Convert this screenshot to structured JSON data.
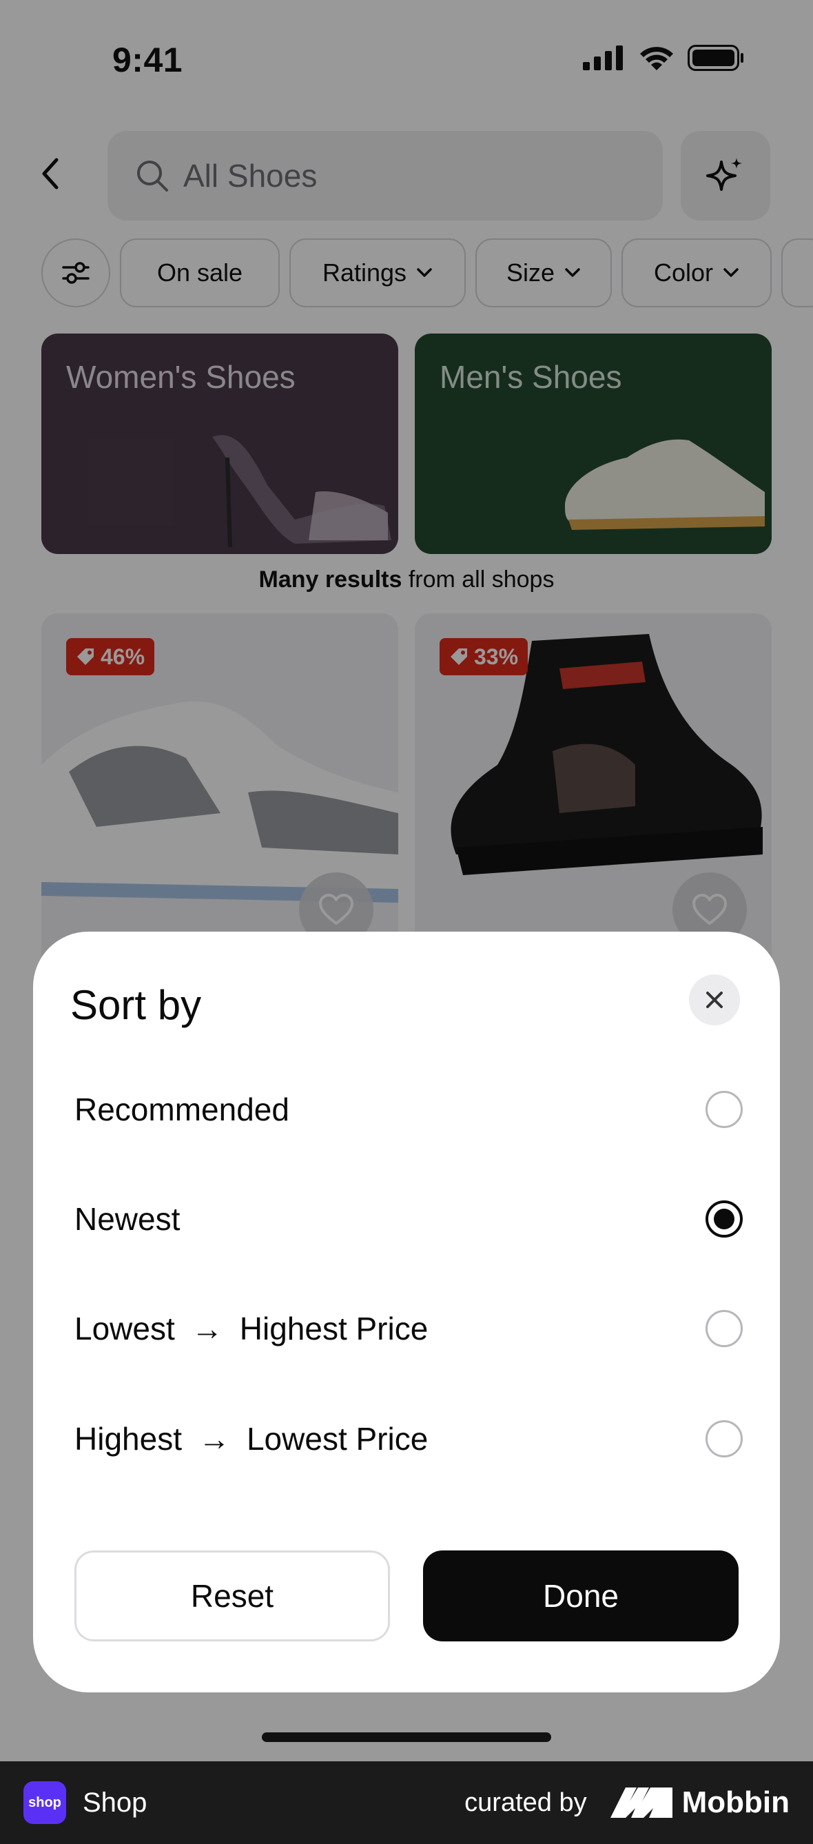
{
  "status_bar": {
    "time": "9:41"
  },
  "search": {
    "placeholder": "All Shoes"
  },
  "filters": {
    "chips": [
      "On sale",
      "Ratings",
      "Size",
      "Color"
    ]
  },
  "categories": [
    {
      "title": "Women's Shoes"
    },
    {
      "title": "Men's Shoes"
    }
  ],
  "results": {
    "bold": "Many results",
    "rest": " from all shops"
  },
  "products": [
    {
      "discount": "46%"
    },
    {
      "discount": "33%"
    }
  ],
  "sort_sheet": {
    "title": "Sort by",
    "options": [
      {
        "label": "Recommended",
        "selected": false
      },
      {
        "label": "Newest",
        "selected": true
      },
      {
        "label_from": "Lowest",
        "label_to": "Highest Price",
        "arrow": "→",
        "selected": false
      },
      {
        "label_from": "Highest",
        "label_to": "Lowest Price",
        "arrow": "→",
        "selected": false
      }
    ],
    "reset_label": "Reset",
    "done_label": "Done"
  },
  "footer": {
    "app_logo_text": "shop",
    "app_name": "Shop",
    "curated_by": "curated by",
    "brand": "Mobbin"
  },
  "colors": {
    "accent": "#0b0b0b",
    "badge": "#dc2a1b",
    "shop_purple": "#5a31f4"
  }
}
